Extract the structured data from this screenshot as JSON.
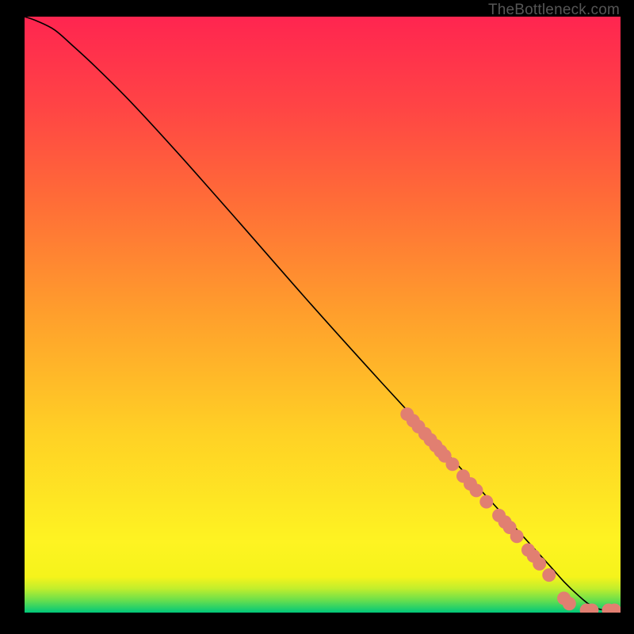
{
  "watermark": "TheBottleneck.com",
  "chart_data": {
    "type": "line",
    "title": "",
    "xlabel": "",
    "ylabel": "",
    "xlim": [
      0,
      100
    ],
    "ylim": [
      0,
      100
    ],
    "grid": false,
    "gradient_bands": [
      {
        "pos": 0.0,
        "color": "#00c87a"
      },
      {
        "pos": 0.022,
        "color": "#6fe04a"
      },
      {
        "pos": 0.04,
        "color": "#c0ee2d"
      },
      {
        "pos": 0.06,
        "color": "#f5f31b"
      },
      {
        "pos": 0.12,
        "color": "#fef322"
      },
      {
        "pos": 0.3,
        "color": "#ffd125"
      },
      {
        "pos": 0.5,
        "color": "#ff9f2c"
      },
      {
        "pos": 0.7,
        "color": "#ff6a38"
      },
      {
        "pos": 0.85,
        "color": "#ff4445"
      },
      {
        "pos": 1.0,
        "color": "#ff2550"
      }
    ],
    "series": [
      {
        "name": "curve",
        "stroke": "#000000",
        "x": [
          0,
          2,
          5,
          8,
          12,
          18,
          26,
          36,
          48,
          60,
          72,
          82,
          88,
          90.5,
          93,
          95,
          97,
          100
        ],
        "y": [
          100,
          99.3,
          97.8,
          95.2,
          91.5,
          85.5,
          76.8,
          65.5,
          51.8,
          38.5,
          25.5,
          14.6,
          8.0,
          5.2,
          2.8,
          1.2,
          0.45,
          0.35
        ]
      }
    ],
    "markers": {
      "color": "#e17f71",
      "radius": 8.5,
      "points": [
        {
          "x": 64.2,
          "y": 33.3
        },
        {
          "x": 65.2,
          "y": 32.2
        },
        {
          "x": 66.1,
          "y": 31.2
        },
        {
          "x": 67.2,
          "y": 30.0
        },
        {
          "x": 68.1,
          "y": 29.0
        },
        {
          "x": 69.0,
          "y": 28.0
        },
        {
          "x": 69.8,
          "y": 27.1
        },
        {
          "x": 70.5,
          "y": 26.3
        },
        {
          "x": 71.8,
          "y": 24.9
        },
        {
          "x": 73.6,
          "y": 22.9
        },
        {
          "x": 74.8,
          "y": 21.6
        },
        {
          "x": 75.8,
          "y": 20.5
        },
        {
          "x": 77.5,
          "y": 18.6
        },
        {
          "x": 79.6,
          "y": 16.3
        },
        {
          "x": 80.6,
          "y": 15.2
        },
        {
          "x": 81.4,
          "y": 14.3
        },
        {
          "x": 82.6,
          "y": 12.8
        },
        {
          "x": 84.5,
          "y": 10.5
        },
        {
          "x": 85.4,
          "y": 9.5
        },
        {
          "x": 86.4,
          "y": 8.2
        },
        {
          "x": 88.0,
          "y": 6.3
        },
        {
          "x": 90.5,
          "y": 2.4
        },
        {
          "x": 91.4,
          "y": 1.5
        },
        {
          "x": 94.3,
          "y": 0.4
        },
        {
          "x": 95.2,
          "y": 0.4
        },
        {
          "x": 98.0,
          "y": 0.4
        },
        {
          "x": 99.0,
          "y": 0.4
        }
      ]
    }
  }
}
